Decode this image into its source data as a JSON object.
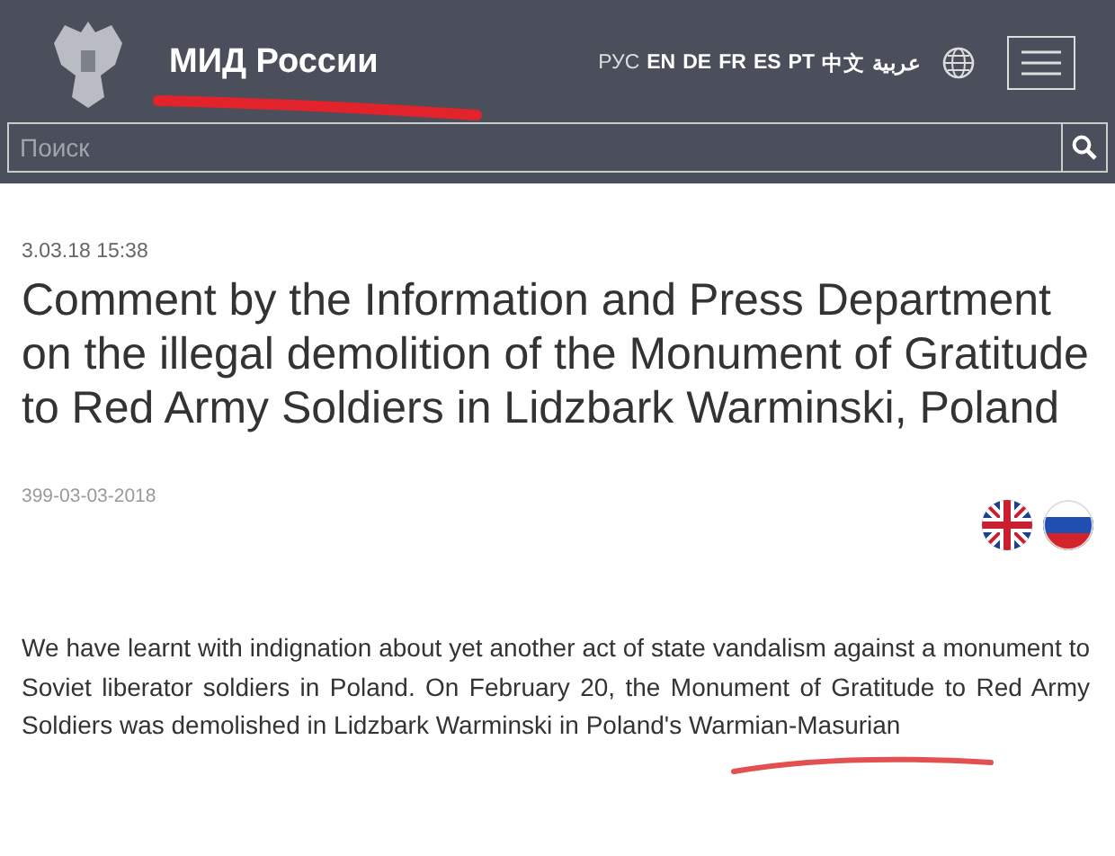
{
  "header": {
    "site_title": "МИД России",
    "languages": [
      {
        "label": "РУС",
        "selected": true
      },
      {
        "label": "EN",
        "selected": false
      },
      {
        "label": "DE",
        "selected": false
      },
      {
        "label": "FR",
        "selected": false
      },
      {
        "label": "ES",
        "selected": false
      },
      {
        "label": "PT",
        "selected": false
      },
      {
        "label": "中文",
        "selected": false
      },
      {
        "label": "عربية",
        "selected": false
      }
    ]
  },
  "search": {
    "placeholder": "Поиск"
  },
  "article": {
    "date": "3.03.18 15:38",
    "title": "Comment by the Information and Press Department on the illegal demolition of the Monument of Gratitude to Red Army Soldiers in Lidzbark Warminski, Poland",
    "reference": "399-03-03-2018",
    "body": "We have learnt with indignation about yet another act of state vandalism against a monument to Soviet liberator soldiers in Poland. On February 20, the Monument of Gratitude to Red Army Soldiers was demolished in Lidzbark Warminski in Poland's Warmian-Masurian"
  }
}
